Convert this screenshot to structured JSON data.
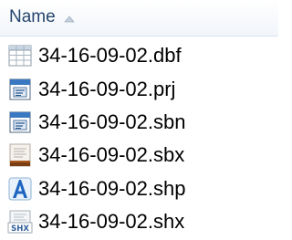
{
  "header": {
    "column_name": "Name"
  },
  "files": [
    {
      "name": "34-16-09-02.dbf",
      "icon": "table-file-icon"
    },
    {
      "name": "34-16-09-02.prj",
      "icon": "document-file-icon"
    },
    {
      "name": "34-16-09-02.sbn",
      "icon": "document-file-icon"
    },
    {
      "name": "34-16-09-02.sbx",
      "icon": "index-file-icon"
    },
    {
      "name": "34-16-09-02.shp",
      "icon": "shapefile-icon"
    },
    {
      "name": "34-16-09-02.shx",
      "icon": "shx-file-icon"
    }
  ]
}
